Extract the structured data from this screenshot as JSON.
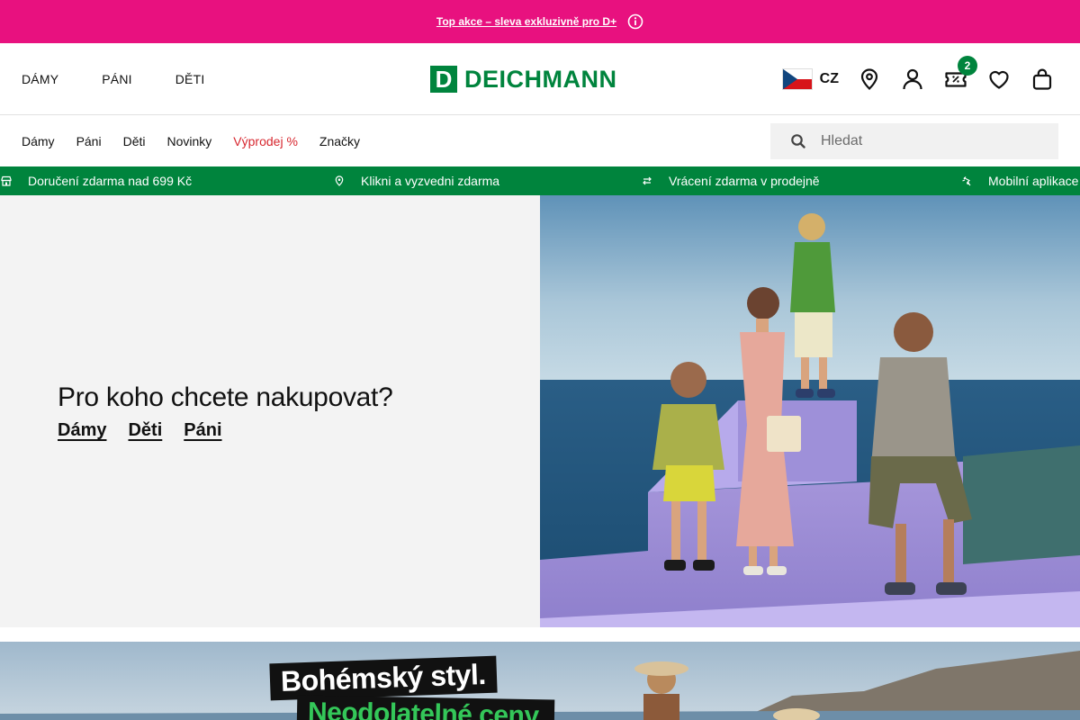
{
  "promo": {
    "text": "Top akce – sleva exkluzivně pro D+"
  },
  "header": {
    "gender_nav": [
      "DÁMY",
      "PÁNI",
      "DĚTI"
    ],
    "logo_mark": "D",
    "logo_text": "DEICHMANN",
    "country_code": "CZ",
    "wallet_badge": "2"
  },
  "subnav": {
    "categories": [
      "Dámy",
      "Páni",
      "Děti",
      "Novinky",
      "Výprodej %",
      "Značky"
    ],
    "search_placeholder": "Hledat"
  },
  "usp": {
    "items": [
      "Doručení zdarma nad 699 Kč",
      "Klikni a vyzvedni zdarma",
      "Vrácení zdarma v prodejně",
      "Mobilní aplikace"
    ]
  },
  "hero": {
    "title": "Pro koho chcete nakupovat?",
    "links": [
      "Dámy",
      "Děti",
      "Páni"
    ]
  },
  "banner2": {
    "headline_1": "Bohémský styl.",
    "headline_2": "Neodolatelné ceny."
  },
  "colors": {
    "promo": "#e8117f",
    "brand_green": "#00843d",
    "sale_red": "#d7272f",
    "hero_bg": "#f3f3f3"
  },
  "icons": [
    "info-icon",
    "location-pin-icon",
    "user-icon",
    "wallet-coupon-icon",
    "heart-icon",
    "shopping-bag-icon",
    "search-icon",
    "store-icon",
    "return-icon",
    "app-icon"
  ]
}
